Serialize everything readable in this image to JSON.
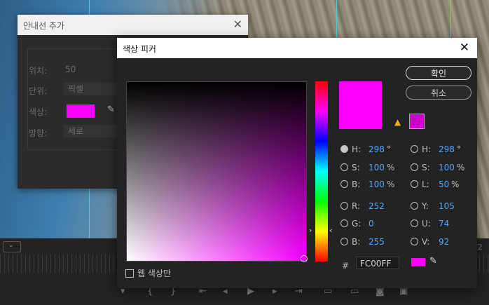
{
  "guide_dialog": {
    "title": "안내선 추가",
    "position_label": "위치:",
    "position_value": "50",
    "unit_label": "단위:",
    "unit_value": "픽셀",
    "color_label": "색상:",
    "direction_label": "방향:",
    "direction_value": "세로"
  },
  "color_picker": {
    "title": "색상 피커",
    "ok_label": "확인",
    "cancel_label": "취소",
    "hsb": [
      {
        "label": "H:",
        "value": "298",
        "unit": "°",
        "selected": true
      },
      {
        "label": "S:",
        "value": "100",
        "unit": "%",
        "selected": false
      },
      {
        "label": "B:",
        "value": "100",
        "unit": "%",
        "selected": false
      }
    ],
    "hsl": [
      {
        "label": "H:",
        "value": "298",
        "unit": "°"
      },
      {
        "label": "S:",
        "value": "100",
        "unit": "%"
      },
      {
        "label": "L:",
        "value": "50",
        "unit": "%"
      }
    ],
    "rgb": [
      {
        "label": "R:",
        "value": "252"
      },
      {
        "label": "G:",
        "value": "0"
      },
      {
        "label": "B:",
        "value": "255"
      }
    ],
    "yuv": [
      {
        "label": "Y:",
        "value": "105"
      },
      {
        "label": "U:",
        "value": "74"
      },
      {
        "label": "V:",
        "value": "92"
      }
    ],
    "hash_label": "#",
    "hex_value": "FC00FF",
    "web_colors_label": "웹 색상만"
  },
  "colors": {
    "current": "#fc00ff",
    "hue_pure": "#f700ff",
    "web_safe": "#cc00cc",
    "accent": "#4aa7ff"
  },
  "icons": {
    "close": "close-icon",
    "eyedropper": "eyedropper-icon",
    "warning": "warning-icon"
  }
}
